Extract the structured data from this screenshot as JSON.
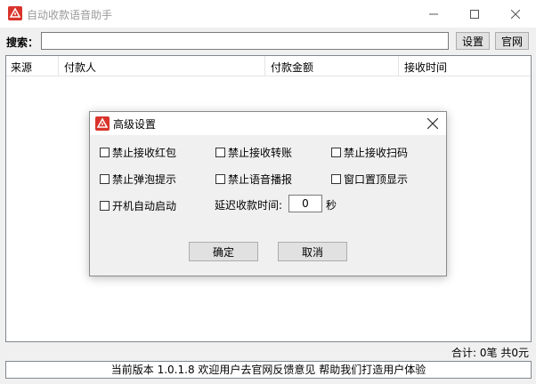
{
  "window": {
    "title": "自动收款语音助手",
    "icon": "red-alert-icon"
  },
  "toolbar": {
    "search_label": "搜索：",
    "search_value": "",
    "settings_label": "设置",
    "website_label": "官网"
  },
  "list": {
    "columns": [
      "来源",
      "付款人",
      "付款金额",
      "接收时间"
    ],
    "rows": []
  },
  "summary": {
    "total_count_text": "合计: 0笔",
    "total_amount_text": "共0元"
  },
  "status": {
    "text": "当前版本 1.0.1.8 欢迎用户去官网反馈意见 帮助我们打造用户体验"
  },
  "dialog": {
    "title": "高级设置",
    "checkboxes": [
      {
        "label": "禁止接收红包",
        "checked": false
      },
      {
        "label": "禁止接收转账",
        "checked": false
      },
      {
        "label": "禁止接收扫码",
        "checked": false
      },
      {
        "label": "禁止弹泡提示",
        "checked": false
      },
      {
        "label": "禁止语音播报",
        "checked": false
      },
      {
        "label": "窗口置顶显示",
        "checked": false
      },
      {
        "label": "开机自动启动",
        "checked": false
      }
    ],
    "delay_label": "延迟收款时间:",
    "delay_value": "0",
    "delay_unit": "秒",
    "ok_label": "确定",
    "cancel_label": "取消"
  },
  "colors": {
    "accent": "#d9342b",
    "window_bg": "#f0f0f0",
    "button_bg": "#e1e1e1"
  }
}
